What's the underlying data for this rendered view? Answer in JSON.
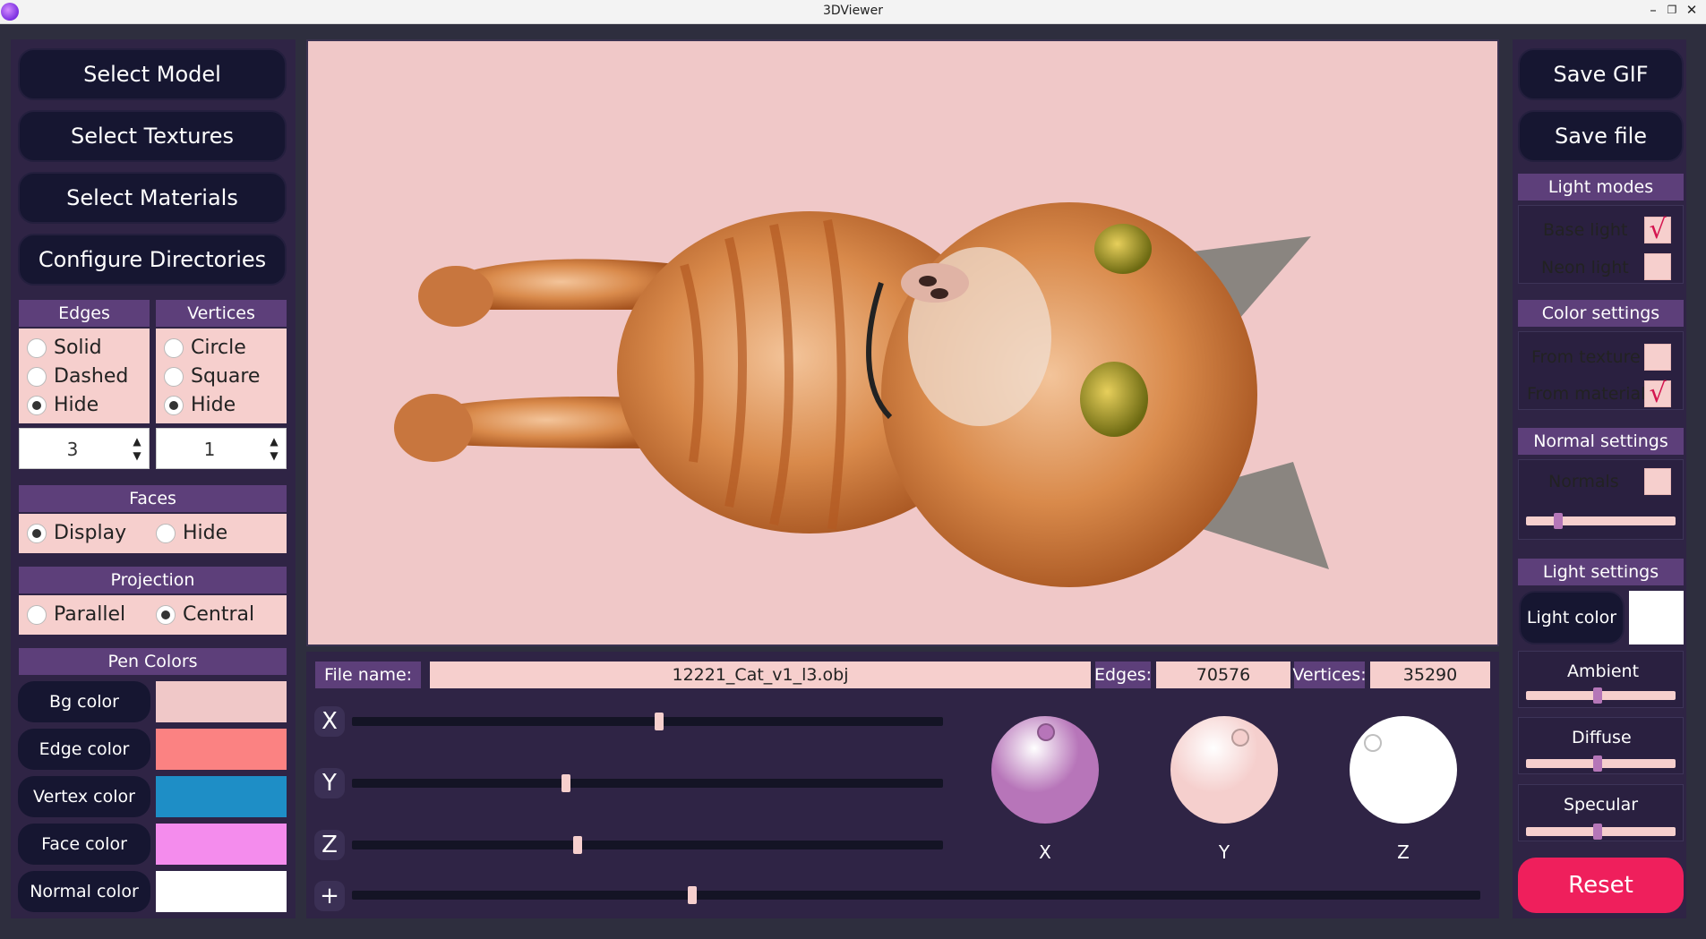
{
  "window": {
    "title": "3DViewer",
    "controls": [
      "–",
      "❐",
      "✕"
    ]
  },
  "left": {
    "buttons": {
      "select_model": "Select Model",
      "select_textures": "Select Textures",
      "select_materials": "Select Materials",
      "configure_dirs": "Configure Directories"
    },
    "edges": {
      "title": "Edges",
      "options": [
        "Solid",
        "Dashed",
        "Hide"
      ],
      "selected": "Hide",
      "thickness": "3"
    },
    "vertices": {
      "title": "Vertices",
      "options": [
        "Circle",
        "Square",
        "Hide"
      ],
      "selected": "Hide",
      "size": "1"
    },
    "faces": {
      "title": "Faces",
      "options": [
        "Display",
        "Hide"
      ],
      "selected": "Display"
    },
    "projection": {
      "title": "Projection",
      "options": [
        "Parallel",
        "Central"
      ],
      "selected": "Central"
    },
    "pen_colors": {
      "title": "Pen Colors",
      "items": [
        {
          "label": "Bg color",
          "color": "#f0c8c8"
        },
        {
          "label": "Edge color",
          "color": "#fb8282"
        },
        {
          "label": "Vertex color",
          "color": "#1e8ec6"
        },
        {
          "label": "Face color",
          "color": "#f48ced"
        },
        {
          "label": "Normal color",
          "color": "#ffffff"
        }
      ]
    }
  },
  "right": {
    "save_gif": "Save GIF",
    "save_file": "Save file",
    "light_modes": {
      "title": "Light modes",
      "base_light": "Base light",
      "base_checked": true,
      "neon_light": "Neon light",
      "neon_checked": false
    },
    "color_settings": {
      "title": "Color settings",
      "from_texture": "From texture",
      "texture_checked": false,
      "from_material": "From material",
      "material_checked": true
    },
    "normal_settings": {
      "title": "Normal settings",
      "normals": "Normals",
      "normals_checked": false,
      "normal_length": 0.2
    },
    "light_settings": {
      "title": "Light settings",
      "light_color_label": "Light color",
      "light_color": "#ffffff",
      "ambient": "Ambient",
      "ambient_value": 0.48,
      "diffuse": "Diffuse",
      "diffuse_value": 0.48,
      "specular": "Specular",
      "specular_value": 0.48
    },
    "reset": "Reset",
    "check_mark": "√"
  },
  "bottom": {
    "file_name_label": "File name:",
    "file_name": "12221_Cat_v1_l3.obj",
    "edges_label": "Edges:",
    "edges_value": "70576",
    "vertices_label": "Vertices:",
    "vertices_value": "35290",
    "axes": [
      {
        "label": "X",
        "value": 0.52
      },
      {
        "label": "Y",
        "value": 0.36
      },
      {
        "label": "Z",
        "value": 0.38
      }
    ],
    "scale": {
      "label": "+",
      "value": 0.3
    },
    "knobs": [
      {
        "label": "X",
        "color": "#b775b9"
      },
      {
        "label": "Y",
        "color": "#f5cfcd"
      },
      {
        "label": "Z",
        "color": "#ffffff"
      }
    ]
  }
}
